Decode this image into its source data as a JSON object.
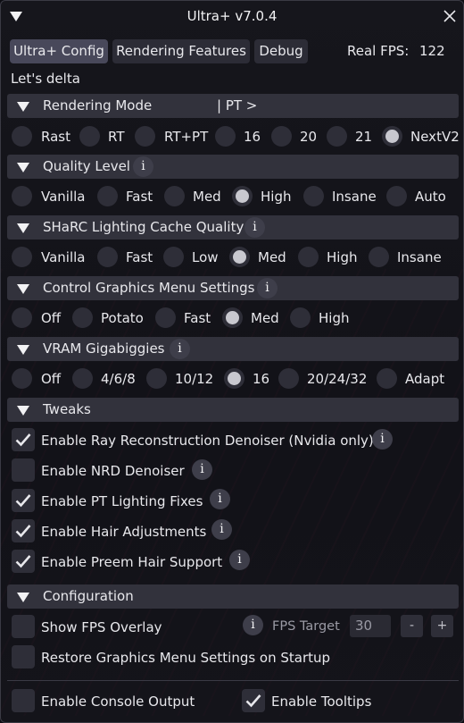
{
  "window": {
    "title": "Ultra+ v7.0.4"
  },
  "tabs": [
    {
      "label": "Ultra+ Config",
      "active": true
    },
    {
      "label": "Rendering Features",
      "active": false
    },
    {
      "label": "Debug",
      "active": false
    }
  ],
  "fps": {
    "label": "Real FPS:",
    "value": "122"
  },
  "status_text": "Let's delta",
  "sections": {
    "rendering_mode": {
      "title": "Rendering Mode",
      "suffix": "| PT >",
      "options": [
        "Rast",
        "RT",
        "RT+PT",
        "16",
        "20",
        "21",
        "NextV2"
      ],
      "selected": "NextV2"
    },
    "quality_level": {
      "title": "Quality Level",
      "info": "i",
      "options": [
        "Vanilla",
        "Fast",
        "Med",
        "High",
        "Insane",
        "Auto"
      ],
      "selected": "High"
    },
    "sharc": {
      "title": "SHaRC Lighting Cache Quality",
      "info": "i",
      "options": [
        "Vanilla",
        "Fast",
        "Low",
        "Med",
        "High",
        "Insane"
      ],
      "selected": "Med"
    },
    "control_graphics": {
      "title": "Control Graphics Menu Settings",
      "info": "i",
      "options": [
        "Off",
        "Potato",
        "Fast",
        "Med",
        "High"
      ],
      "selected": "Med"
    },
    "vram": {
      "title": "VRAM Gigabiggies",
      "info": "i",
      "options": [
        "Off",
        "4/6/8",
        "10/12",
        "16",
        "20/24/32",
        "Adapt"
      ],
      "selected": "16"
    },
    "tweaks": {
      "title": "Tweaks",
      "items": [
        {
          "label": "Enable Ray Reconstruction Denoiser (Nvidia only)",
          "checked": true,
          "info": "i"
        },
        {
          "label": "Enable NRD Denoiser",
          "checked": false,
          "info": "i"
        },
        {
          "label": "Enable PT Lighting Fixes",
          "checked": true,
          "info": "i"
        },
        {
          "label": "Enable Hair Adjustments",
          "checked": true,
          "info": "i"
        },
        {
          "label": "Enable Preem Hair Support",
          "checked": true,
          "info": "i"
        }
      ]
    },
    "configuration": {
      "title": "Configuration",
      "show_fps": {
        "label": "Show FPS Overlay",
        "checked": false,
        "info": "i"
      },
      "fps_target": {
        "label": "FPS Target",
        "value": "30",
        "minus": "-",
        "plus": "+"
      },
      "restore": {
        "label": "Restore Graphics Menu Settings on Startup",
        "checked": false
      },
      "console": {
        "label": "Enable Console Output",
        "checked": false
      },
      "tooltips": {
        "label": "Enable Tooltips",
        "checked": true
      }
    }
  },
  "colors": {
    "accent_check": "#e8e8ec",
    "header_bg": "#32323c",
    "tab_active": "#48485a"
  }
}
